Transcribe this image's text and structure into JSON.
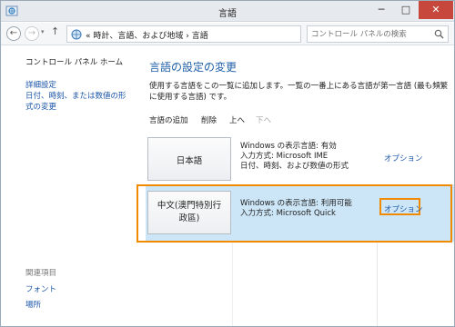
{
  "window": {
    "title": "言語",
    "minimize": "─",
    "maximize": "□",
    "close": "✕"
  },
  "address": {
    "back": "←",
    "forward": "→",
    "up": "↑",
    "crumbs": "« 時計、言語、および地域 › 言語",
    "search_placeholder": "コントロール パネルの検索"
  },
  "sidebar": {
    "home": "コントロール パネル ホーム",
    "advanced": "詳細設定",
    "datetime": "日付、時刻、または数値の形式の変更",
    "related_title": "関連項目",
    "font": "フォント",
    "location": "場所"
  },
  "main": {
    "title": "言語の設定の変更",
    "description": "使用する言語をこの一覧に追加します。一覧の一番上にある言語が第一言語 (最も頻繁に使用する言語) です。",
    "toolbar": {
      "add": "言語の追加",
      "remove": "削除",
      "up": "上へ",
      "down": "下へ"
    },
    "languages": [
      {
        "name": "日本語",
        "display": "Windows の表示言語: 有効",
        "input": "入力方式: Microsoft IME",
        "format": "日付、時刻、および数値の形式",
        "options": "オプション"
      },
      {
        "name": "中文(澳門特別行政區)",
        "display": "Windows の表示言語: 利用可能",
        "input": "入力方式: Microsoft Quick",
        "options": "オプション"
      }
    ]
  },
  "colors": {
    "accent": "#1f5fa8",
    "selected_row": "#cde6f7",
    "highlight": "#f08a00",
    "close_button": "#c7473c"
  }
}
